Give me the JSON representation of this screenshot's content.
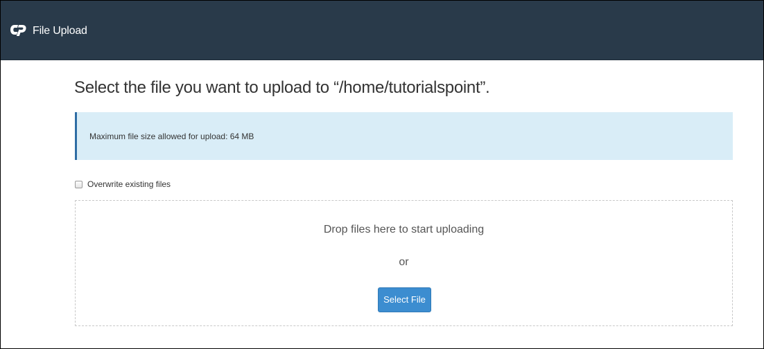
{
  "header": {
    "logo_icon": "cpanel-logo-icon",
    "title": "File Upload",
    "background_color": "#293a4a"
  },
  "main": {
    "heading": "Select the file you want to upload to “/home/tutorialspoint”.",
    "info_message": "Maximum file size allowed for upload: 64 MB",
    "overwrite_checkbox": {
      "label": "Overwrite existing files",
      "checked": false
    },
    "dropzone": {
      "prompt": "Drop files here to start uploading",
      "separator": "or",
      "button_label": "Select File"
    }
  },
  "colors": {
    "accent": "#3c8dd0",
    "info_background": "#d9edf7",
    "info_border": "#2e6da4"
  }
}
